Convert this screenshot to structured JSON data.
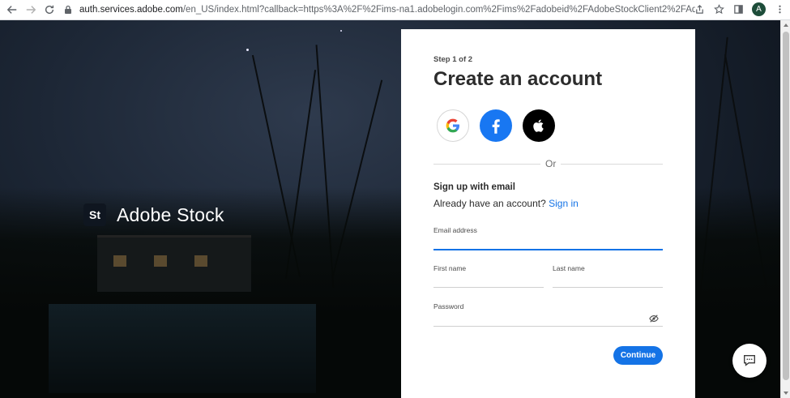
{
  "browser": {
    "url_host": "auth.services.adobe.com",
    "url_rest": "/en_US/index.html?callback=https%3A%2F%2Fims-na1.adobelogin.com%2Fims%2Fadobeid%2FAdobeStockClient2%2FAdobeID%2Fcode%3Fre...",
    "profile_initial": "A",
    "icons": [
      "back-icon",
      "forward-icon",
      "reload-icon",
      "lock-icon",
      "share-icon",
      "star-icon",
      "sidepanel-icon",
      "menu-icon"
    ]
  },
  "brand": {
    "logo_text": "St",
    "name": "Adobe Stock"
  },
  "card": {
    "step": "Step 1 of 2",
    "title": "Create an account",
    "social": [
      "google",
      "facebook",
      "apple"
    ],
    "or": "Or",
    "signup_heading": "Sign up with email",
    "have_account": "Already have an account?",
    "sign_in": "Sign in",
    "email_label": "Email address",
    "email_value": "",
    "first_name_label": "First name",
    "first_name_value": "",
    "last_name_label": "Last name",
    "last_name_value": "",
    "password_label": "Password",
    "password_value": "",
    "continue_label": "Continue"
  },
  "colors": {
    "accent": "#1473e6",
    "facebook": "#1877f2",
    "apple": "#000000"
  }
}
